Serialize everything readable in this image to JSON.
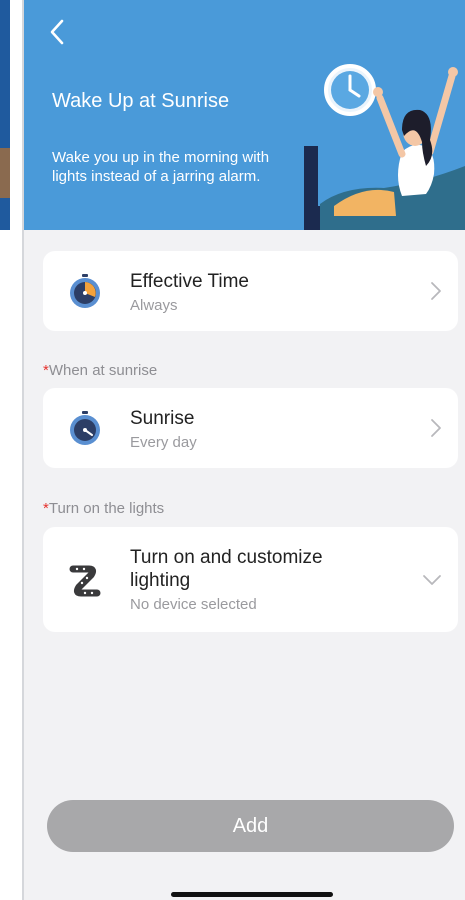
{
  "header": {
    "title": "Wake Up at Sunrise",
    "description": "Wake you up in the morning with lights instead of a jarring alarm."
  },
  "effective_time": {
    "title": "Effective Time",
    "value": "Always"
  },
  "section_when": {
    "marker": "*",
    "label": "When at sunrise"
  },
  "sunrise": {
    "title": "Sunrise",
    "value": "Every day"
  },
  "section_lights": {
    "marker": "*",
    "label": "Turn on the lights"
  },
  "lights": {
    "title": "Turn on and customize lighting",
    "value": "No device selected"
  },
  "add_button": {
    "label": "Add"
  },
  "colors": {
    "hero": "#4a9ad9",
    "required": "#e5322d",
    "button_disabled": "#a8a8aa"
  },
  "icons": [
    "back-chevron-icon",
    "timer-icon",
    "sunrise-timer-icon",
    "light-strip-icon",
    "chevron-right-icon",
    "chevron-down-icon"
  ]
}
